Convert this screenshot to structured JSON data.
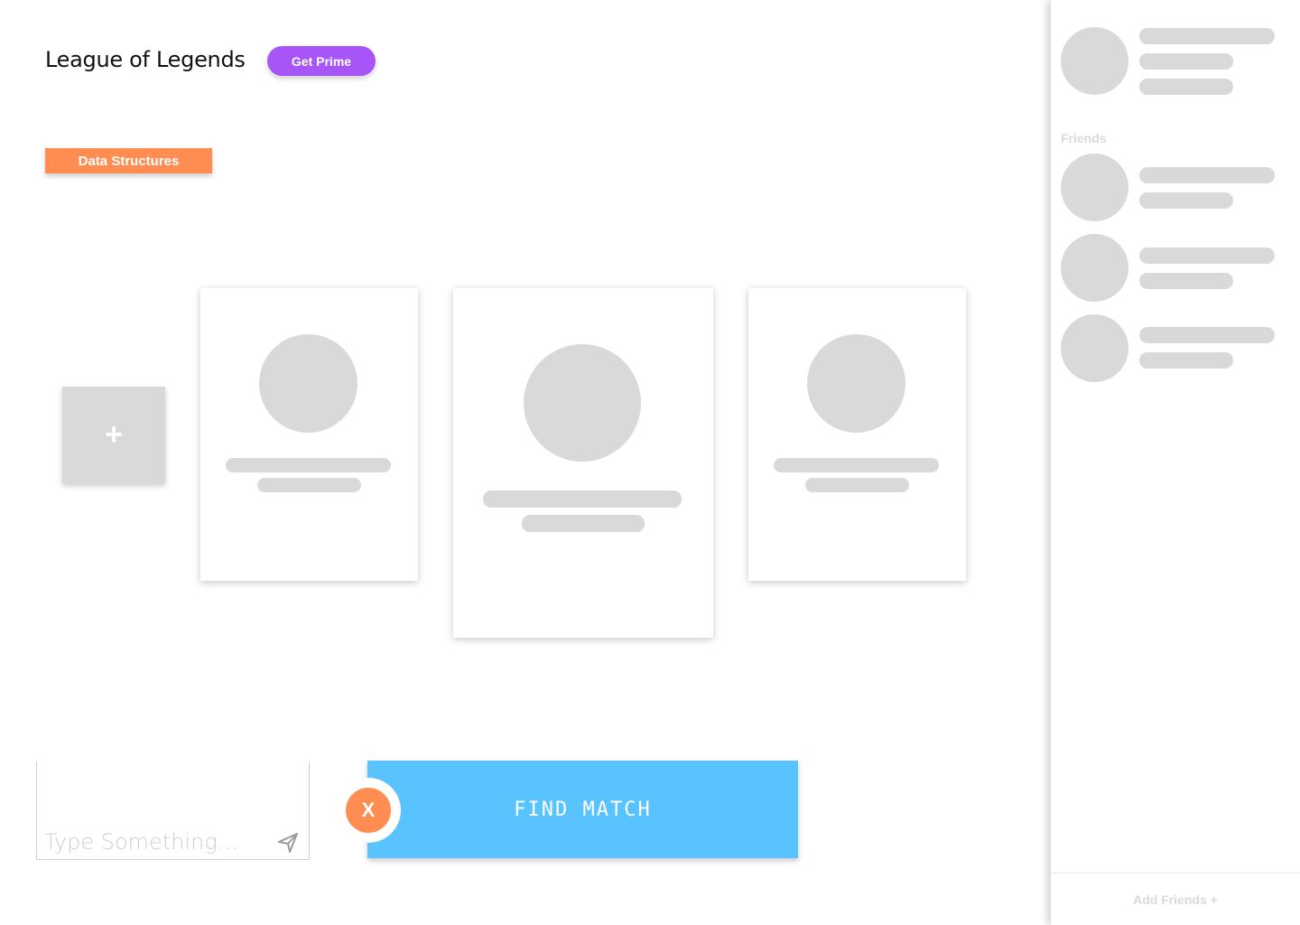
{
  "header": {
    "title": "League of Legends",
    "prime_label": "Get Prime"
  },
  "tag": {
    "label": "Data Structures"
  },
  "add_tile": {
    "label": "+"
  },
  "chat": {
    "placeholder": "Type Something...",
    "send_icon": "send-icon"
  },
  "match": {
    "find_label": "FIND MATCH",
    "cancel_label": "X"
  },
  "sidebar": {
    "friends_label": "Friends",
    "add_friends_label": "Add Friends +"
  },
  "colors": {
    "prime": "#a855f7",
    "tag": "#ff8c50",
    "find_match": "#58c3ff",
    "cancel": "#ff8c50",
    "placeholder": "#d9d9d9"
  }
}
